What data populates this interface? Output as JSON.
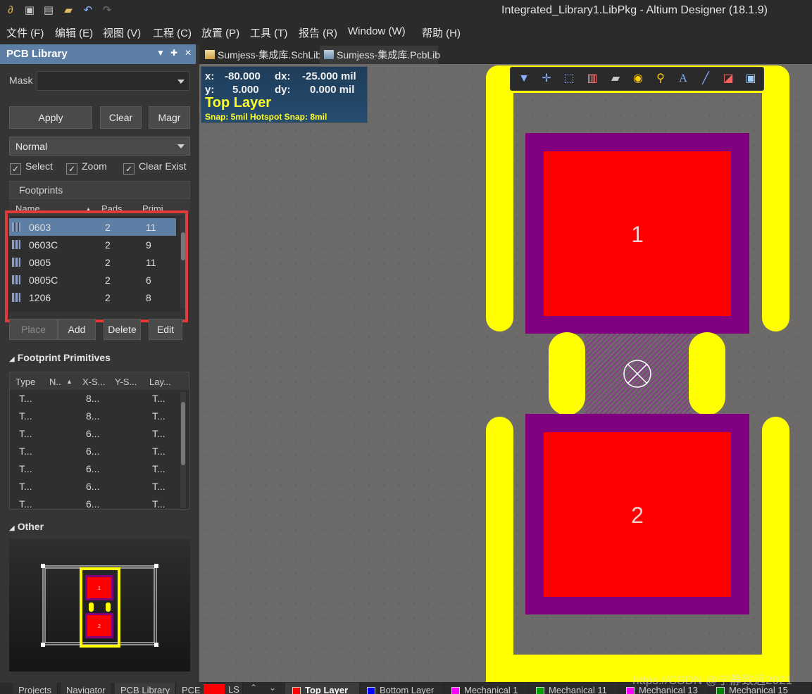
{
  "window": {
    "title": "Integrated_Library1.LibPkg - Altium Designer (18.1.9)"
  },
  "menu": [
    "文件 (F)",
    "编辑 (E)",
    "视图 (V)",
    "工程 (C)",
    "放置 (P)",
    "工具 (T)",
    "报告 (R)",
    "Window (W)",
    "帮助 (H)"
  ],
  "panel": {
    "title": "PCB Library",
    "mask_label": "Mask",
    "mask_value": "",
    "buttons": {
      "apply": "Apply",
      "clear": "Clear",
      "magnify": "Magr"
    },
    "mode": "Normal",
    "checks": [
      {
        "label": "Select",
        "checked": true
      },
      {
        "label": "Zoom",
        "checked": true
      },
      {
        "label": "Clear Exist",
        "checked": true
      }
    ],
    "footprints": {
      "header": "Footprints",
      "columns": [
        "Name",
        "Pads",
        "Primi"
      ],
      "rows": [
        {
          "name": "0603",
          "pads": "2",
          "prims": "11",
          "selected": true
        },
        {
          "name": "0603C",
          "pads": "2",
          "prims": "9"
        },
        {
          "name": "0805",
          "pads": "2",
          "prims": "11"
        },
        {
          "name": "0805C",
          "pads": "2",
          "prims": "6"
        },
        {
          "name": "1206",
          "pads": "2",
          "prims": "8"
        }
      ],
      "actions": {
        "place": "Place",
        "add": "Add",
        "delete": "Delete",
        "edit": "Edit"
      }
    },
    "primitives": {
      "title": "Footprint Primitives",
      "columns": [
        "Type",
        "N..",
        "X-S...",
        "Y-S...",
        "Lay..."
      ],
      "rows": [
        [
          "T...",
          "",
          "8...",
          "",
          "T..."
        ],
        [
          "T...",
          "",
          "8...",
          "",
          "T..."
        ],
        [
          "T...",
          "",
          "6...",
          "",
          "T..."
        ],
        [
          "T...",
          "",
          "6...",
          "",
          "T..."
        ],
        [
          "T...",
          "",
          "6...",
          "",
          "T..."
        ],
        [
          "T...",
          "",
          "6...",
          "",
          "T..."
        ],
        [
          "T...",
          "",
          "6...",
          "",
          "T..."
        ]
      ]
    },
    "other": {
      "title": "Other",
      "pad1": "1",
      "pad2": "2"
    }
  },
  "doc_tabs": [
    {
      "label": "Sumjess-集成库.SchLib",
      "active": false
    },
    {
      "label": "Sumjess-集成库.PcbLib",
      "active": true
    }
  ],
  "canvas": {
    "coords": {
      "x_label": "x:",
      "x": "-80.000",
      "dx_label": "dx:",
      "dx": "-25.000 mil",
      "y_label": "y:",
      "y": "5.000",
      "dy_label": "dy:",
      "dy": "0.000  mil",
      "layer": "Top Layer",
      "snap": "Snap: 5mil Hotspot Snap: 8mil"
    },
    "pad1_label": "1",
    "pad2_label": "2",
    "colors": {
      "overlay": "#ffff00",
      "solder_mask": "#800080",
      "top_layer": "#ff0000",
      "background": "#6d6b69"
    }
  },
  "bottom_tabs": [
    "Projects",
    "Navigator",
    "PCB Library",
    "PCE"
  ],
  "layer_tabs": [
    {
      "label": "LS",
      "color": "#ff0000"
    },
    {
      "label": "Top Layer",
      "color": "#ff0000",
      "active": true
    },
    {
      "label": "Bottom Layer",
      "color": "#0000ff"
    },
    {
      "label": "Mechanical 1",
      "color": "#ff00ff"
    },
    {
      "label": "Mechanical 11",
      "color": "#00a000"
    },
    {
      "label": "Mechanical 13",
      "color": "#ff00ff"
    },
    {
      "label": "Mechanical 15",
      "color": "#008000"
    }
  ],
  "watermark": "https://CSDN @宁静致远2021"
}
